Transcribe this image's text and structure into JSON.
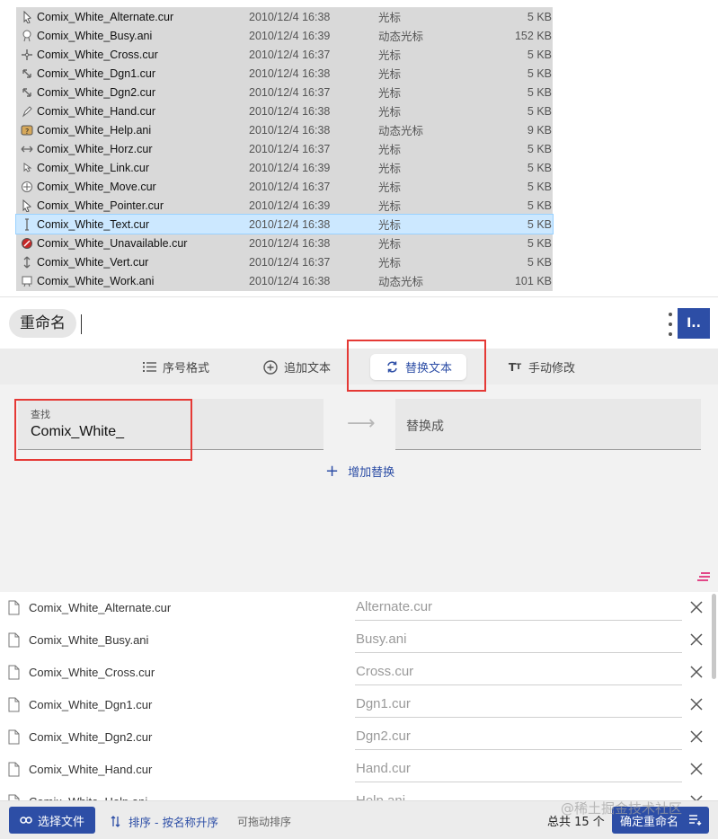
{
  "explorer": {
    "files": [
      {
        "name": "Comix_White_Alternate.cur",
        "date": "2010/12/4 16:38",
        "type": "光标",
        "size": "5 KB",
        "icon": "cursor-file-icon",
        "selected": false
      },
      {
        "name": "Comix_White_Busy.ani",
        "date": "2010/12/4 16:39",
        "type": "动态光标",
        "size": "152 KB",
        "icon": "animated-cursor-file-icon",
        "selected": false
      },
      {
        "name": "Comix_White_Cross.cur",
        "date": "2010/12/4 16:37",
        "type": "光标",
        "size": "5 KB",
        "icon": "crosshair-cursor-icon",
        "selected": false
      },
      {
        "name": "Comix_White_Dgn1.cur",
        "date": "2010/12/4 16:38",
        "type": "光标",
        "size": "5 KB",
        "icon": "diagonal-resize-icon",
        "selected": false
      },
      {
        "name": "Comix_White_Dgn2.cur",
        "date": "2010/12/4 16:37",
        "type": "光标",
        "size": "5 KB",
        "icon": "diagonal-resize-icon",
        "selected": false
      },
      {
        "name": "Comix_White_Hand.cur",
        "date": "2010/12/4 16:38",
        "type": "光标",
        "size": "5 KB",
        "icon": "pen-cursor-icon",
        "selected": false
      },
      {
        "name": "Comix_White_Help.ani",
        "date": "2010/12/4 16:38",
        "type": "动态光标",
        "size": "9 KB",
        "icon": "help-cursor-icon",
        "selected": false
      },
      {
        "name": "Comix_White_Horz.cur",
        "date": "2010/12/4 16:37",
        "type": "光标",
        "size": "5 KB",
        "icon": "horizontal-resize-icon",
        "selected": false
      },
      {
        "name": "Comix_White_Link.cur",
        "date": "2010/12/4 16:39",
        "type": "光标",
        "size": "5 KB",
        "icon": "link-cursor-icon",
        "selected": false
      },
      {
        "name": "Comix_White_Move.cur",
        "date": "2010/12/4 16:37",
        "type": "光标",
        "size": "5 KB",
        "icon": "move-cursor-icon",
        "selected": false
      },
      {
        "name": "Comix_White_Pointer.cur",
        "date": "2010/12/4 16:39",
        "type": "光标",
        "size": "5 KB",
        "icon": "pointer-cursor-icon",
        "selected": false
      },
      {
        "name": "Comix_White_Text.cur",
        "date": "2010/12/4 16:38",
        "type": "光标",
        "size": "5 KB",
        "icon": "text-cursor-icon",
        "selected": true
      },
      {
        "name": "Comix_White_Unavailable.cur",
        "date": "2010/12/4 16:38",
        "type": "光标",
        "size": "5 KB",
        "icon": "unavailable-cursor-icon",
        "selected": false
      },
      {
        "name": "Comix_White_Vert.cur",
        "date": "2010/12/4 16:37",
        "type": "光标",
        "size": "5 KB",
        "icon": "vertical-resize-icon",
        "selected": false
      },
      {
        "name": "Comix_White_Work.ani",
        "date": "2010/12/4 16:38",
        "type": "动态光标",
        "size": "101 KB",
        "icon": "working-cursor-icon",
        "selected": false
      }
    ]
  },
  "app": {
    "title": "重命名",
    "avatar_text": "I..",
    "tabs": [
      {
        "label": "序号格式",
        "icon": "numbered-list-icon",
        "active": false
      },
      {
        "label": "追加文本",
        "icon": "add-circle-icon",
        "active": false
      },
      {
        "label": "替换文本",
        "icon": "replace-icon",
        "active": true
      },
      {
        "label": "手动修改",
        "icon": "text-format-icon",
        "active": false
      }
    ],
    "find": {
      "label": "查找",
      "value": "Comix_White_"
    },
    "replace": {
      "placeholder": "替换成"
    },
    "add_replace_label": "增加替换",
    "rename_list": [
      {
        "original": "Comix_White_Alternate.cur",
        "new": "Alternate.cur"
      },
      {
        "original": "Comix_White_Busy.ani",
        "new": "Busy.ani"
      },
      {
        "original": "Comix_White_Cross.cur",
        "new": "Cross.cur"
      },
      {
        "original": "Comix_White_Dgn1.cur",
        "new": "Dgn1.cur"
      },
      {
        "original": "Comix_White_Dgn2.cur",
        "new": "Dgn2.cur"
      },
      {
        "original": "Comix_White_Hand.cur",
        "new": "Hand.cur"
      },
      {
        "original": "Comix_White_Help.ani",
        "new": "Help.ani"
      }
    ],
    "footer": {
      "select_files": "选择文件",
      "sort": "排序 - 按名称升序",
      "drag_hint": "可拖动排序",
      "total": "总共 15 个",
      "confirm": "确定重命名"
    },
    "watermark": "@稀土掘金技术社区",
    "colors": {
      "accent": "#2d4ea6",
      "highlight_box": "#e53935",
      "selected_row": "#cce8ff"
    }
  }
}
